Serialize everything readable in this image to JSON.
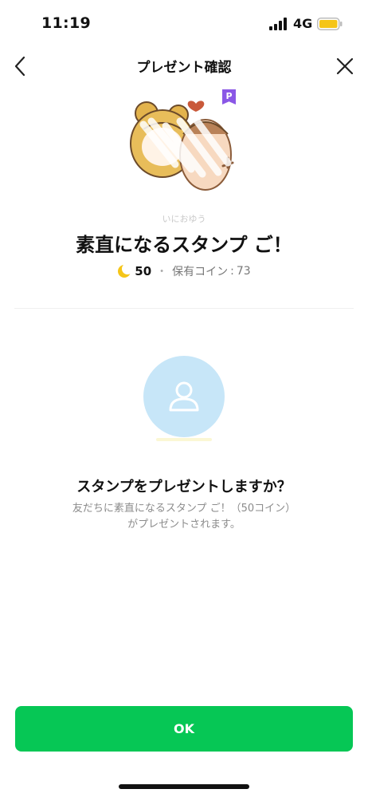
{
  "status_bar": {
    "time": "11:19",
    "network": "4G",
    "battery_color": "#f5c518"
  },
  "nav": {
    "title": "プレゼント確認",
    "back_icon": "chevron-left-icon",
    "close_icon": "close-icon"
  },
  "product": {
    "premium_badge": "P",
    "premium_color": "#8a57e6",
    "author": "いにおゆう",
    "title": "素直になるスタンプ ご！",
    "coin_icon": "crescent-moon-coin-icon",
    "price": "50",
    "separator": "・",
    "owned_coins_label": "保有コイン",
    "owned_coins_separator": ":",
    "owned_coins_value": "73"
  },
  "recipient": {
    "avatar_icon": "person-icon",
    "avatar_color": "#c7e6f8"
  },
  "confirm": {
    "question": "スタンプをプレゼントしますか？",
    "description_line1": "友だちに素直になるスタンプ ご！（50コイン）",
    "description_line2": "がプレゼントされます。"
  },
  "ok_button": {
    "label": "OK",
    "color": "#06c755"
  }
}
